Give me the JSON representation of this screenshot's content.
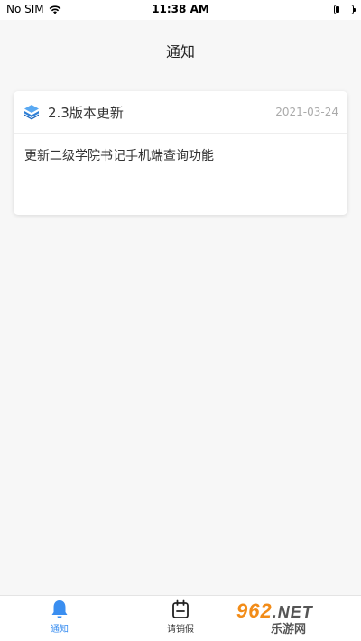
{
  "status_bar": {
    "carrier": "No SIM",
    "time": "11:38 AM"
  },
  "header": {
    "title": "通知"
  },
  "notices": [
    {
      "title": "2.3版本更新",
      "date": "2021-03-24",
      "content": "更新二级学院书记手机端查询功能"
    }
  ],
  "tab_bar": {
    "tabs": [
      {
        "label": "通知",
        "icon": "bell-icon",
        "active": true
      },
      {
        "label": "请销假",
        "icon": "calendar-icon",
        "active": false
      }
    ]
  },
  "watermark": {
    "brand": "962",
    "suffix": ".NET",
    "subtitle": "乐游网"
  },
  "colors": {
    "accent": "#3a8ef0",
    "background": "#f7f7f7",
    "watermark_orange": "#f28c18"
  }
}
